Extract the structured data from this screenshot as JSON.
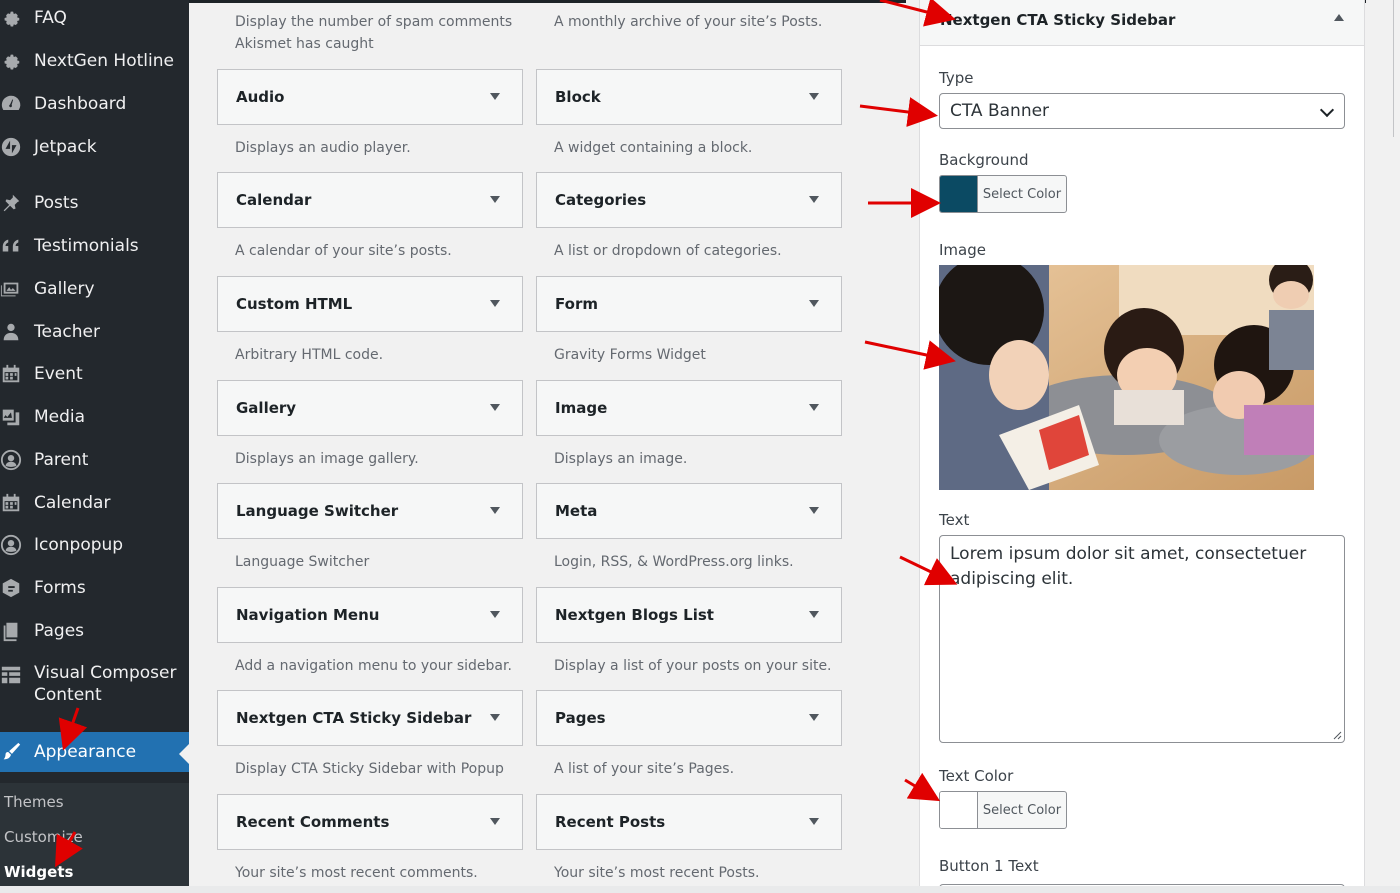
{
  "sidebar": {
    "items": [
      {
        "label": "FAQ",
        "icon": "gear-icon"
      },
      {
        "label": "NextGen Hotline",
        "icon": "gear-icon"
      },
      {
        "label": "Dashboard",
        "icon": "dashboard-icon"
      },
      {
        "label": "Jetpack",
        "icon": "jetpack-icon"
      },
      {
        "label": "Posts",
        "icon": "pin-icon"
      },
      {
        "label": "Testimonials",
        "icon": "quote-icon"
      },
      {
        "label": "Gallery",
        "icon": "gallery-icon"
      },
      {
        "label": "Teacher",
        "icon": "user-icon"
      },
      {
        "label": "Event",
        "icon": "calendar-icon"
      },
      {
        "label": "Media",
        "icon": "media-icon"
      },
      {
        "label": "Parent",
        "icon": "user-circle-icon"
      },
      {
        "label": "Calendar",
        "icon": "calendar-icon"
      },
      {
        "label": "Iconpopup",
        "icon": "user-circle-icon"
      },
      {
        "label": "Forms",
        "icon": "forms-icon"
      },
      {
        "label": "Pages",
        "icon": "pages-icon"
      },
      {
        "label": "Visual Composer Content",
        "icon": "grid-icon"
      },
      {
        "label": "Appearance",
        "icon": "brush-icon"
      }
    ],
    "submenu": [
      "Themes",
      "Customize",
      "Widgets"
    ]
  },
  "widgets": {
    "top_desc_left": "Display the number of spam comments Akismet has caught",
    "top_desc_right": "A monthly archive of your site’s Posts.",
    "rows": [
      {
        "left": {
          "name": "Audio",
          "desc": "Displays an audio player."
        },
        "right": {
          "name": "Block",
          "desc": "A widget containing a block."
        }
      },
      {
        "left": {
          "name": "Calendar",
          "desc": "A calendar of your site’s posts."
        },
        "right": {
          "name": "Categories",
          "desc": "A list or dropdown of categories."
        }
      },
      {
        "left": {
          "name": "Custom HTML",
          "desc": "Arbitrary HTML code."
        },
        "right": {
          "name": "Form",
          "desc": "Gravity Forms Widget"
        }
      },
      {
        "left": {
          "name": "Gallery",
          "desc": "Displays an image gallery."
        },
        "right": {
          "name": "Image",
          "desc": "Displays an image."
        }
      },
      {
        "left": {
          "name": "Language Switcher",
          "desc": "Language Switcher"
        },
        "right": {
          "name": "Meta",
          "desc": "Login, RSS, & WordPress.org links."
        }
      },
      {
        "left": {
          "name": "Navigation Menu",
          "desc": "Add a navigation menu to your sidebar."
        },
        "right": {
          "name": "Nextgen Blogs List",
          "desc": "Display a list of your posts on your site."
        }
      },
      {
        "left": {
          "name": "Nextgen CTA Sticky Sidebar",
          "desc": "Display CTA Sticky Sidebar with Popup"
        },
        "right": {
          "name": "Pages",
          "desc": "A list of your site’s Pages."
        }
      },
      {
        "left": {
          "name": "Recent Comments",
          "desc": "Your site’s most recent comments."
        },
        "right": {
          "name": "Recent Posts",
          "desc": "Your site’s most recent Posts."
        }
      }
    ]
  },
  "panel": {
    "title": "Nextgen CTA Sticky Sidebar",
    "type_label": "Type",
    "type_value": "CTA Banner",
    "background_label": "Background",
    "background_color": "#0b4a63",
    "select_color": "Select Color",
    "image_label": "Image",
    "text_label": "Text",
    "text_value": "Lorem ipsum dolor sit amet, consectetuer adipiscing elit.",
    "text_color_label": "Text Color",
    "text_color_value": "#ffffff",
    "button1_label": "Button 1 Text"
  },
  "colors": {
    "sidebar_bg": "#23282d",
    "active_bg": "#2271b1",
    "annotation": "#e00000"
  }
}
